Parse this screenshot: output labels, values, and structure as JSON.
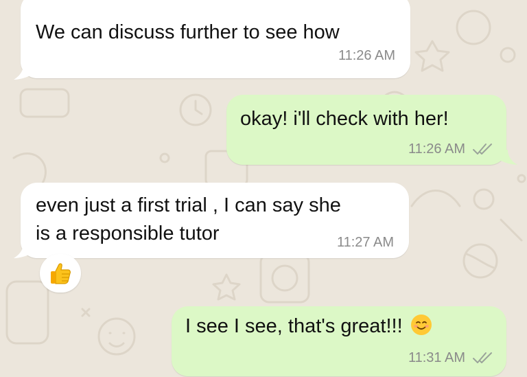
{
  "messages": [
    {
      "direction": "incoming",
      "text": "We can discuss further to see how",
      "time": "11:26 AM"
    },
    {
      "direction": "outgoing",
      "text": "okay! i'll check with her!",
      "time": "11:26 AM",
      "status": "read-double-check-icon"
    },
    {
      "direction": "incoming",
      "lines": [
        "even just a first trial , I can say she",
        "is a responsible tutor"
      ],
      "time": "11:27 AM",
      "reaction": "thumbs-up-icon"
    },
    {
      "direction": "outgoing",
      "text": "I see I see, that's great!!!",
      "emoji": "smiling-face-icon",
      "time": "11:31 AM",
      "status": "read-double-check-icon"
    }
  ],
  "colors": {
    "wallpaper": "#ece6dc",
    "incoming_bubble": "#ffffff",
    "outgoing_bubble": "#dcf8c6",
    "timestamp": "#8a8a8a",
    "ticks": "#9aa39a"
  }
}
